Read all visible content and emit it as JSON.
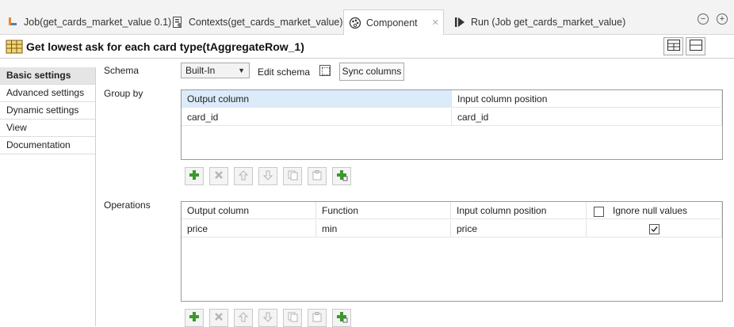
{
  "tabs": [
    {
      "label": "Job(get_cards_market_value 0.1)",
      "icon": "job-icon"
    },
    {
      "label": "Contexts(get_cards_market_value)",
      "icon": "contexts-icon"
    },
    {
      "label": "Component",
      "icon": "component-palette-icon",
      "active": true
    },
    {
      "label": "Run (Job get_cards_market_value)",
      "icon": "run-icon"
    }
  ],
  "title": "Get lowest ask for each card type(tAggregateRow_1)",
  "sidebar": {
    "items": [
      {
        "label": "Basic settings",
        "active": true
      },
      {
        "label": "Advanced settings"
      },
      {
        "label": "Dynamic settings"
      },
      {
        "label": "View"
      },
      {
        "label": "Documentation"
      }
    ]
  },
  "schema": {
    "label": "Schema",
    "selected": "Built-In",
    "edit_label": "Edit schema",
    "sync_label": "Sync columns"
  },
  "group_by": {
    "label": "Group by",
    "columns": [
      "Output column",
      "Input column position"
    ],
    "rows": [
      [
        "card_id",
        "card_id"
      ]
    ]
  },
  "operations": {
    "label": "Operations",
    "columns": [
      "Output column",
      "Function",
      "Input column position",
      "Ignore null values"
    ],
    "rows": [
      {
        "output": "price",
        "function": "min",
        "input": "price",
        "ignore_null": true
      }
    ]
  },
  "colors": {
    "accent_selected_header": "#dcebfa",
    "add_green": "#3a9a2a",
    "disabled_gray": "#b5b5b5"
  }
}
